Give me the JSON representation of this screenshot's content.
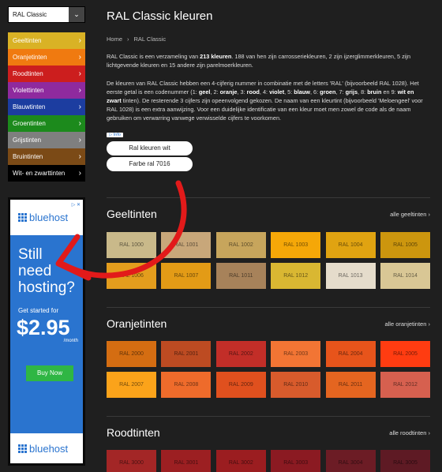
{
  "sidebar": {
    "selector_label": "RAL Classic",
    "selector_icon": "chevron-down-icon",
    "items": [
      {
        "label": "Geeltinten",
        "color": "#d9b225"
      },
      {
        "label": "Oranjetinten",
        "color": "#f07a10"
      },
      {
        "label": "Roodtinten",
        "color": "#cc1e1e"
      },
      {
        "label": "Violettinten",
        "color": "#8f2a9e"
      },
      {
        "label": "Blauwtinten",
        "color": "#1c3da0"
      },
      {
        "label": "Groentinten",
        "color": "#1c8a1c"
      },
      {
        "label": "Grijstinten",
        "color": "#7f7f7f"
      },
      {
        "label": "Bruintinten",
        "color": "#7b4a16"
      },
      {
        "label": "Wit- en zwarttinten",
        "color": "#000000"
      }
    ]
  },
  "ad": {
    "choices": "▷ ✕",
    "brand": "bluehost",
    "headline": [
      "Still",
      "need",
      "hosting?"
    ],
    "sub": "Get started for",
    "price": "$2.95",
    "per": "/month",
    "cta": "Buy Now",
    "bg": "#2a74cf"
  },
  "main": {
    "title": "RAL Classic kleuren",
    "breadcrumb": [
      "Home",
      "RAL Classic"
    ],
    "intro_1": {
      "a": "RAL Classic is een verzameling van ",
      "b": "213 kleuren",
      "c": ". 188 van hen zijn carrosseriekleuren, 2 zijn ijzerglimmerkleuren, 5 zijn lichtgevende kleuren en 15 andere zijn parelmoerkleuren."
    },
    "intro_2": {
      "a": "De kleuren van RAL Classic hebben een 4-cijferig nummer in combinatie met de letters 'RAL' (bijvoorbeeld RAL 1028). Het eerste getal is een codenummer (1: ",
      "geel": "geel",
      "s1": ", 2: ",
      "oranje": "oranje",
      "s2": ", 3: ",
      "rood": "rood",
      "s3": ", 4: ",
      "violet": "violet",
      "s4": ", 5: ",
      "blauw": "blauw",
      "s5": ", 6: ",
      "groen": "groen",
      "s6": ", 7: ",
      "grijs": "grijs",
      "s7": ", 8: ",
      "bruin": "bruin",
      "s8": " en 9: ",
      "witzwart": "wit en zwart",
      "b": " tinten). De resterende 3 cijfers zijn opeenvolgend gekozen. De naam van een kleurtint (bijvoorbeeld 'Meloengeel' voor RAL 1028) is een extra aanwijzing. Voor een duidelijke identificatie van een kleur moet men zowel de code als de naam gebruiken om verwarring vanwege verwisselde cijfers te voorkomen."
    },
    "info_badge": "▷ Info",
    "pills": [
      "Ral kleuren wit",
      "Farbe ral 7016"
    ]
  },
  "sections": [
    {
      "title": "Geeltinten",
      "link": "alle geeltinten",
      "swatches": [
        {
          "code": "RAL 1000",
          "color": "#c9b98a"
        },
        {
          "code": "RAL 1001",
          "color": "#c8a77a"
        },
        {
          "code": "RAL 1002",
          "color": "#c7a55c"
        },
        {
          "code": "RAL 1003",
          "color": "#f5a708"
        },
        {
          "code": "RAL 1004",
          "color": "#e0a311"
        },
        {
          "code": "RAL 1005",
          "color": "#cc960e"
        },
        {
          "code": "RAL 1006",
          "color": "#e39d1d"
        },
        {
          "code": "RAL 1007",
          "color": "#e39b16"
        },
        {
          "code": "RAL 1011",
          "color": "#a7825a"
        },
        {
          "code": "RAL 1012",
          "color": "#d9b732"
        },
        {
          "code": "RAL 1013",
          "color": "#e5dccb"
        },
        {
          "code": "RAL 1014",
          "color": "#d9c795"
        }
      ]
    },
    {
      "title": "Oranjetinten",
      "link": "alle oranjetinten",
      "swatches": [
        {
          "code": "RAL 2000",
          "color": "#d46d12"
        },
        {
          "code": "RAL 2001",
          "color": "#bd4b22"
        },
        {
          "code": "RAL 2002",
          "color": "#c22e28"
        },
        {
          "code": "RAL 2003",
          "color": "#f27534"
        },
        {
          "code": "RAL 2004",
          "color": "#e7541b"
        },
        {
          "code": "RAL 2005",
          "color": "#ff3c11"
        },
        {
          "code": "RAL 2007",
          "color": "#fba31a"
        },
        {
          "code": "RAL 2008",
          "color": "#ee6b2b"
        },
        {
          "code": "RAL 2009",
          "color": "#e0501e"
        },
        {
          "code": "RAL 2010",
          "color": "#d85b2c"
        },
        {
          "code": "RAL 2011",
          "color": "#e46520"
        },
        {
          "code": "RAL 2012",
          "color": "#d6604f"
        }
      ]
    },
    {
      "title": "Roodtinten",
      "link": "alle roodtinten",
      "swatches": [
        {
          "code": "RAL 3000",
          "color": "#a32626"
        },
        {
          "code": "RAL 3001",
          "color": "#9c1f22"
        },
        {
          "code": "RAL 3002",
          "color": "#9b1d20"
        },
        {
          "code": "RAL 3003",
          "color": "#8b1a22"
        },
        {
          "code": "RAL 3004",
          "color": "#6c1c25"
        },
        {
          "code": "RAL 3005",
          "color": "#5e1a24"
        }
      ]
    }
  ]
}
